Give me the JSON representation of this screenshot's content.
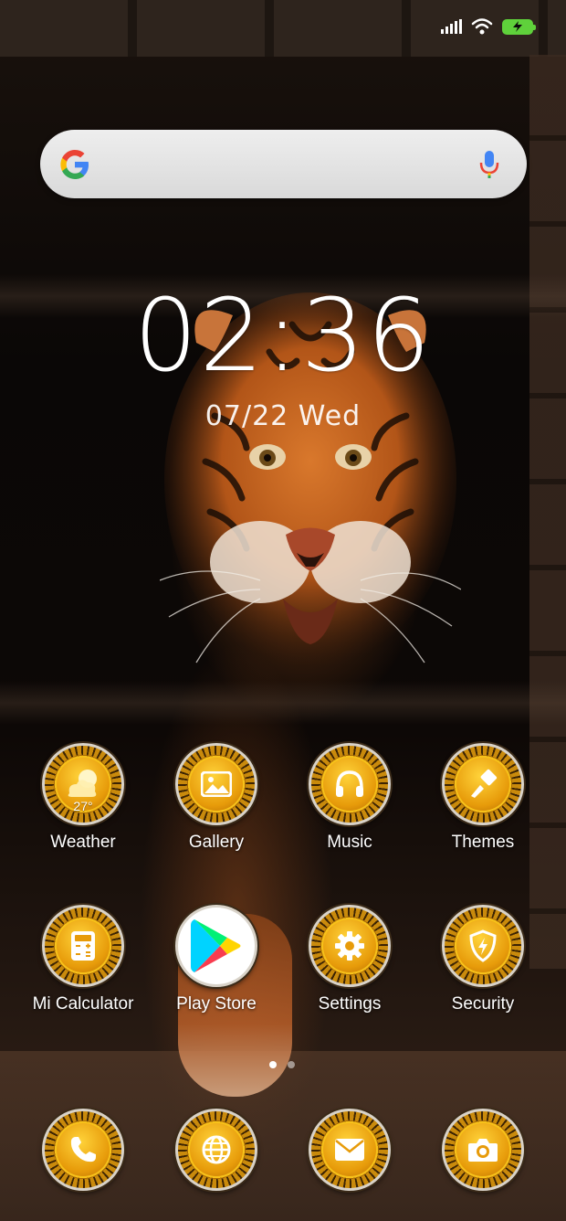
{
  "status_bar": {
    "icons": [
      "signal-icon",
      "wifi-icon",
      "battery-charging-icon"
    ],
    "battery_color": "#5fd13b"
  },
  "search": {
    "logo": "google-logo-icon",
    "mic": "microphone-icon"
  },
  "clock": {
    "time": "02:36",
    "date": "07/22 Wed"
  },
  "apps": [
    {
      "label": "Weather",
      "icon": "weather-icon",
      "temp": "27°"
    },
    {
      "label": "Gallery",
      "icon": "gallery-icon"
    },
    {
      "label": "Music",
      "icon": "headphones-icon"
    },
    {
      "label": "Themes",
      "icon": "brush-icon"
    },
    {
      "label": "Mi Calculator",
      "icon": "calculator-icon"
    },
    {
      "label": "Play Store",
      "icon": "play-store-icon"
    },
    {
      "label": "Settings",
      "icon": "gear-icon"
    },
    {
      "label": "Security",
      "icon": "shield-icon"
    }
  ],
  "dock": [
    {
      "icon": "phone-icon"
    },
    {
      "icon": "browser-icon"
    },
    {
      "icon": "messaging-icon"
    },
    {
      "icon": "camera-icon"
    }
  ],
  "pages": {
    "count": 2,
    "current": 1
  },
  "theme": {
    "accent": "#f7c21a",
    "ring_dark": "#3b2303"
  }
}
